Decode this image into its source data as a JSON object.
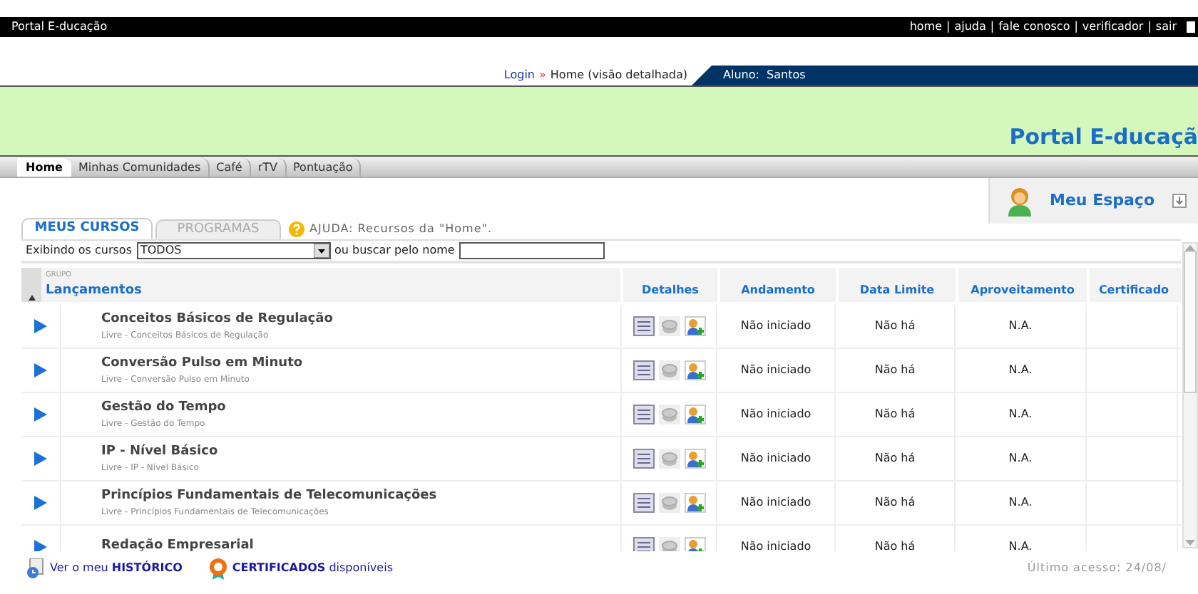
{
  "top_bar": {
    "title": "Portal E-ducação",
    "separator": "|",
    "links": [
      "home",
      "ajuda",
      "fale conosco",
      "verificador",
      "sair"
    ]
  },
  "breadcrumb": {
    "link": "Login",
    "arrow": "»",
    "current": "Home (visão detalhada)"
  },
  "user_tab": "Aluno:  Santos",
  "banner": {
    "title": "Portal E-ducaçã"
  },
  "nav_tabs": [
    {
      "label": "Home",
      "selected": true
    },
    {
      "label": "Minhas Comunidades",
      "selected": false
    },
    {
      "label": "Café",
      "selected": false
    },
    {
      "label": "rTV",
      "selected": false
    },
    {
      "label": "Pontuação",
      "selected": false
    }
  ],
  "my_space": {
    "label": "Meu Espaço"
  },
  "course_tabs": [
    {
      "label": "MEUS CURSOS",
      "selected": true
    },
    {
      "label": "PROGRAMAS",
      "selected": false
    }
  ],
  "help": "AJUDA: Recursos da \"Home\".",
  "filter": {
    "label": "Exibindo os cursos",
    "value": "TODOS",
    "search_label": "ou buscar pelo nome"
  },
  "table": {
    "group_caption": "GRUPO",
    "group": "Lançamentos",
    "columns": [
      "Detalhes",
      "Andamento",
      "Data Limite",
      "Aproveitamento",
      "Certificado"
    ],
    "rows": [
      {
        "title": "Conceitos Básicos de Regulação",
        "subtitle": "Livre - Conceitos Básicos de Regulação",
        "status": "Não iniciado",
        "deadline": "Não há",
        "score": "N.A."
      },
      {
        "title": "Conversão Pulso em Minuto",
        "subtitle": "Livre - Conversão Pulso em Minuto",
        "status": "Não iniciado",
        "deadline": "Não há",
        "score": "N.A."
      },
      {
        "title": "Gestão do Tempo",
        "subtitle": "Livre - Gestão do Tempo",
        "status": "Não iniciado",
        "deadline": "Não há",
        "score": "N.A."
      },
      {
        "title": "IP - Nível Básico",
        "subtitle": "Livre - IP - Nível Básico",
        "status": "Não iniciado",
        "deadline": "Não há",
        "score": "N.A."
      },
      {
        "title": "Princípios Fundamentais de Telecomunicações",
        "subtitle": "Livre - Princípios Fundamentais de Telecomunicações",
        "status": "Não iniciado",
        "deadline": "Não há",
        "score": "N.A."
      },
      {
        "title": "Redação Empresarial",
        "status": "Não iniciado",
        "deadline": "Não há",
        "score": "N.A."
      }
    ]
  },
  "footer": {
    "history": "Ver o meu **HISTÓRICO**",
    "certificates": "**CERTIFICADOS** disponíveis",
    "last_access": "Último acesso: 24/08/"
  }
}
